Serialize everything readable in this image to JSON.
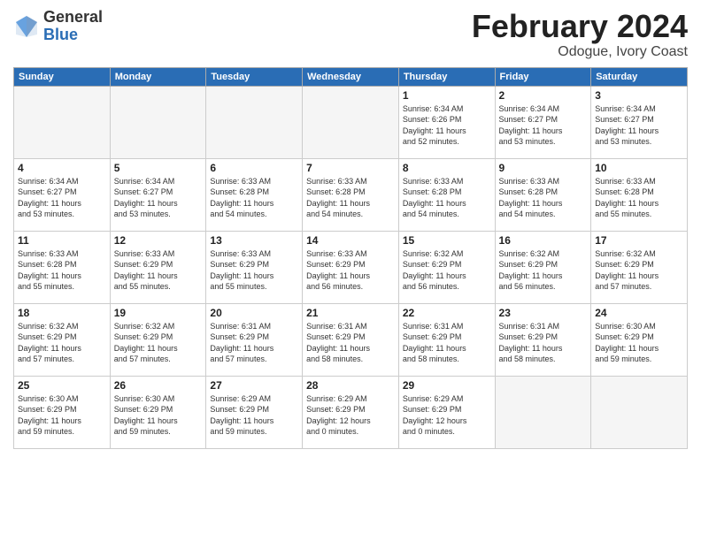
{
  "logo": {
    "general": "General",
    "blue": "Blue"
  },
  "title": "February 2024",
  "location": "Odogue, Ivory Coast",
  "weekdays": [
    "Sunday",
    "Monday",
    "Tuesday",
    "Wednesday",
    "Thursday",
    "Friday",
    "Saturday"
  ],
  "weeks": [
    [
      {
        "day": "",
        "info": ""
      },
      {
        "day": "",
        "info": ""
      },
      {
        "day": "",
        "info": ""
      },
      {
        "day": "",
        "info": ""
      },
      {
        "day": "1",
        "info": "Sunrise: 6:34 AM\nSunset: 6:26 PM\nDaylight: 11 hours\nand 52 minutes."
      },
      {
        "day": "2",
        "info": "Sunrise: 6:34 AM\nSunset: 6:27 PM\nDaylight: 11 hours\nand 53 minutes."
      },
      {
        "day": "3",
        "info": "Sunrise: 6:34 AM\nSunset: 6:27 PM\nDaylight: 11 hours\nand 53 minutes."
      }
    ],
    [
      {
        "day": "4",
        "info": "Sunrise: 6:34 AM\nSunset: 6:27 PM\nDaylight: 11 hours\nand 53 minutes."
      },
      {
        "day": "5",
        "info": "Sunrise: 6:34 AM\nSunset: 6:27 PM\nDaylight: 11 hours\nand 53 minutes."
      },
      {
        "day": "6",
        "info": "Sunrise: 6:33 AM\nSunset: 6:28 PM\nDaylight: 11 hours\nand 54 minutes."
      },
      {
        "day": "7",
        "info": "Sunrise: 6:33 AM\nSunset: 6:28 PM\nDaylight: 11 hours\nand 54 minutes."
      },
      {
        "day": "8",
        "info": "Sunrise: 6:33 AM\nSunset: 6:28 PM\nDaylight: 11 hours\nand 54 minutes."
      },
      {
        "day": "9",
        "info": "Sunrise: 6:33 AM\nSunset: 6:28 PM\nDaylight: 11 hours\nand 54 minutes."
      },
      {
        "day": "10",
        "info": "Sunrise: 6:33 AM\nSunset: 6:28 PM\nDaylight: 11 hours\nand 55 minutes."
      }
    ],
    [
      {
        "day": "11",
        "info": "Sunrise: 6:33 AM\nSunset: 6:28 PM\nDaylight: 11 hours\nand 55 minutes."
      },
      {
        "day": "12",
        "info": "Sunrise: 6:33 AM\nSunset: 6:29 PM\nDaylight: 11 hours\nand 55 minutes."
      },
      {
        "day": "13",
        "info": "Sunrise: 6:33 AM\nSunset: 6:29 PM\nDaylight: 11 hours\nand 55 minutes."
      },
      {
        "day": "14",
        "info": "Sunrise: 6:33 AM\nSunset: 6:29 PM\nDaylight: 11 hours\nand 56 minutes."
      },
      {
        "day": "15",
        "info": "Sunrise: 6:32 AM\nSunset: 6:29 PM\nDaylight: 11 hours\nand 56 minutes."
      },
      {
        "day": "16",
        "info": "Sunrise: 6:32 AM\nSunset: 6:29 PM\nDaylight: 11 hours\nand 56 minutes."
      },
      {
        "day": "17",
        "info": "Sunrise: 6:32 AM\nSunset: 6:29 PM\nDaylight: 11 hours\nand 57 minutes."
      }
    ],
    [
      {
        "day": "18",
        "info": "Sunrise: 6:32 AM\nSunset: 6:29 PM\nDaylight: 11 hours\nand 57 minutes."
      },
      {
        "day": "19",
        "info": "Sunrise: 6:32 AM\nSunset: 6:29 PM\nDaylight: 11 hours\nand 57 minutes."
      },
      {
        "day": "20",
        "info": "Sunrise: 6:31 AM\nSunset: 6:29 PM\nDaylight: 11 hours\nand 57 minutes."
      },
      {
        "day": "21",
        "info": "Sunrise: 6:31 AM\nSunset: 6:29 PM\nDaylight: 11 hours\nand 58 minutes."
      },
      {
        "day": "22",
        "info": "Sunrise: 6:31 AM\nSunset: 6:29 PM\nDaylight: 11 hours\nand 58 minutes."
      },
      {
        "day": "23",
        "info": "Sunrise: 6:31 AM\nSunset: 6:29 PM\nDaylight: 11 hours\nand 58 minutes."
      },
      {
        "day": "24",
        "info": "Sunrise: 6:30 AM\nSunset: 6:29 PM\nDaylight: 11 hours\nand 59 minutes."
      }
    ],
    [
      {
        "day": "25",
        "info": "Sunrise: 6:30 AM\nSunset: 6:29 PM\nDaylight: 11 hours\nand 59 minutes."
      },
      {
        "day": "26",
        "info": "Sunrise: 6:30 AM\nSunset: 6:29 PM\nDaylight: 11 hours\nand 59 minutes."
      },
      {
        "day": "27",
        "info": "Sunrise: 6:29 AM\nSunset: 6:29 PM\nDaylight: 11 hours\nand 59 minutes."
      },
      {
        "day": "28",
        "info": "Sunrise: 6:29 AM\nSunset: 6:29 PM\nDaylight: 12 hours\nand 0 minutes."
      },
      {
        "day": "29",
        "info": "Sunrise: 6:29 AM\nSunset: 6:29 PM\nDaylight: 12 hours\nand 0 minutes."
      },
      {
        "day": "",
        "info": ""
      },
      {
        "day": "",
        "info": ""
      }
    ]
  ]
}
